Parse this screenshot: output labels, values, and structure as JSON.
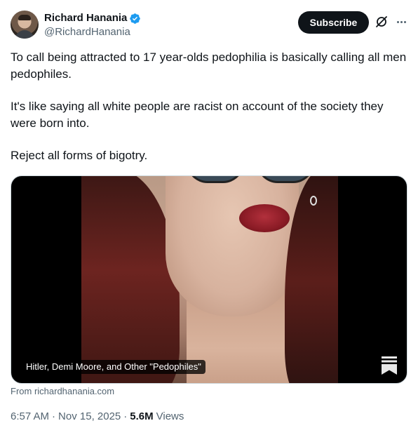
{
  "author": {
    "display_name": "Richard Hanania",
    "handle": "@RichardHanania",
    "verified": true,
    "verified_color": "#1d9bf0"
  },
  "header": {
    "subscribe_label": "Subscribe",
    "grok_icon": "grok-icon",
    "more_icon": "more-icon"
  },
  "tweet": {
    "paragraphs": [
      "To call being attracted to 17 year-olds pedophilia is basically calling all men pedophiles.",
      "It's like saying all white people are racist on account of the society they were born into.",
      "Reject all forms of bigotry."
    ]
  },
  "card": {
    "title": "Hitler, Demi Moore, and Other \"Pedophiles\"",
    "source": "From richardhanania.com",
    "icon": "substack-icon"
  },
  "meta": {
    "time": "6:57 AM",
    "separator": "·",
    "date": "Nov 15, 2025",
    "views_count": "5.6M",
    "views_label": "Views"
  }
}
